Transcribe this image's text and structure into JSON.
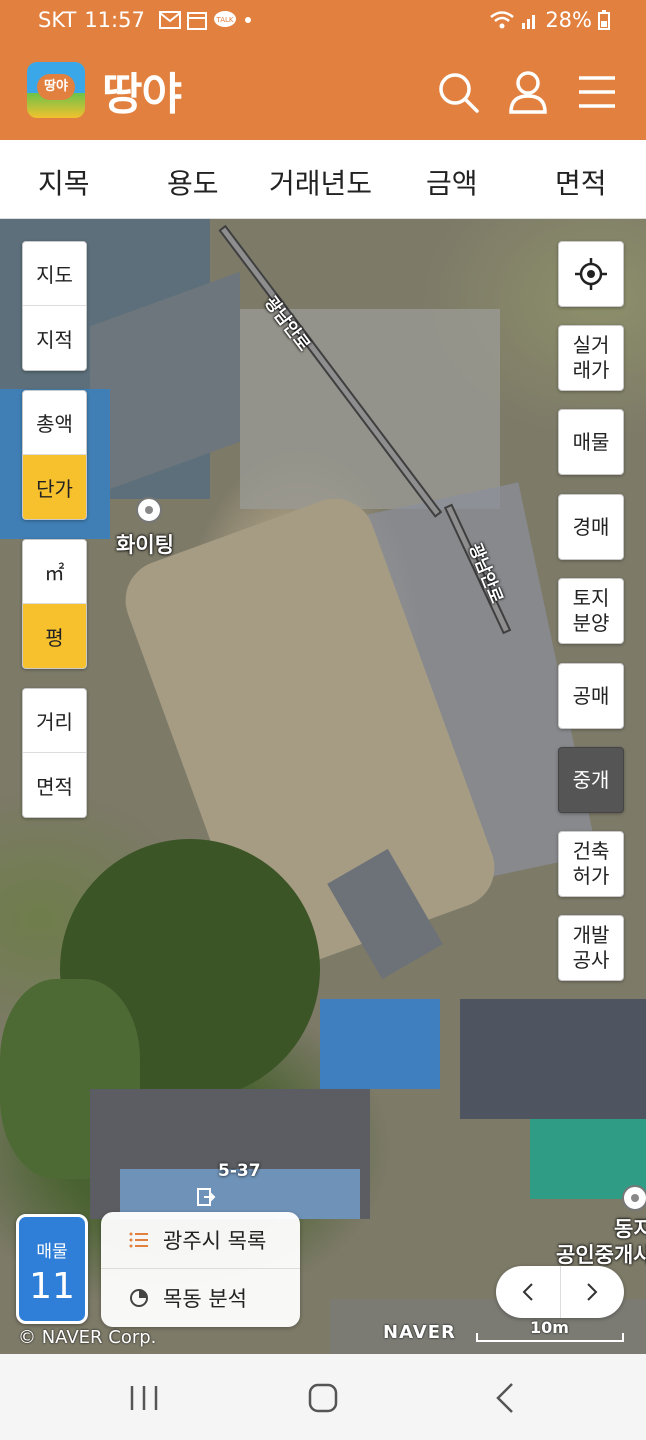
{
  "status_bar": {
    "carrier": "SKT",
    "time": "11:57",
    "notifications": [
      "mail-icon",
      "calendar-icon",
      "kakaotalk-icon",
      "dot-icon"
    ],
    "battery": "28%"
  },
  "header": {
    "logo_badge_text": "땅야",
    "logo_text": "땅야",
    "icons": [
      "search-icon",
      "user-icon",
      "menu-icon"
    ]
  },
  "filters": {
    "land_category": "지목",
    "usage": "용도",
    "trade_year": "거래년도",
    "amount": "금액",
    "area": "면적"
  },
  "left_controls": {
    "map_group": {
      "map": "지도",
      "cadastral": "지적"
    },
    "price_group": {
      "total": "총액",
      "unit": "단가",
      "active": "단가"
    },
    "unit_group": {
      "sqm": "㎡",
      "pyeong": "평",
      "active": "평"
    },
    "measure_group": {
      "distance": "거리",
      "area": "면적"
    }
  },
  "right_controls": {
    "locate_icon": "crosshair-icon",
    "actual_trade": "실거래가",
    "actual_trade_line1": "실거",
    "actual_trade_line2": "래가",
    "listing": "매물",
    "auction": "경매",
    "land_sale_line1": "토지",
    "land_sale_line2": "분양",
    "public_auction": "공매",
    "brokerage": "중개",
    "building_permit_line1": "건축",
    "building_permit_line2": "허가",
    "dev_construction_line1": "개발",
    "dev_construction_line2": "공사"
  },
  "map": {
    "road_name": "광남안로",
    "place_name": "화이팅",
    "lot_number": "5-37",
    "edge_label_1": "동지",
    "edge_label_2": "공인중개사",
    "naver_logo": "NAVER",
    "scale": "10m",
    "copyright": "© NAVER Corp."
  },
  "listing_badge": {
    "label": "매물",
    "count": "11"
  },
  "actions": {
    "list": "광주시 목록",
    "analysis": "목동 분석"
  },
  "colors": {
    "brand_orange": "#e2813f",
    "active_yellow": "#f7c12e",
    "badge_blue": "#2f7fd8"
  }
}
